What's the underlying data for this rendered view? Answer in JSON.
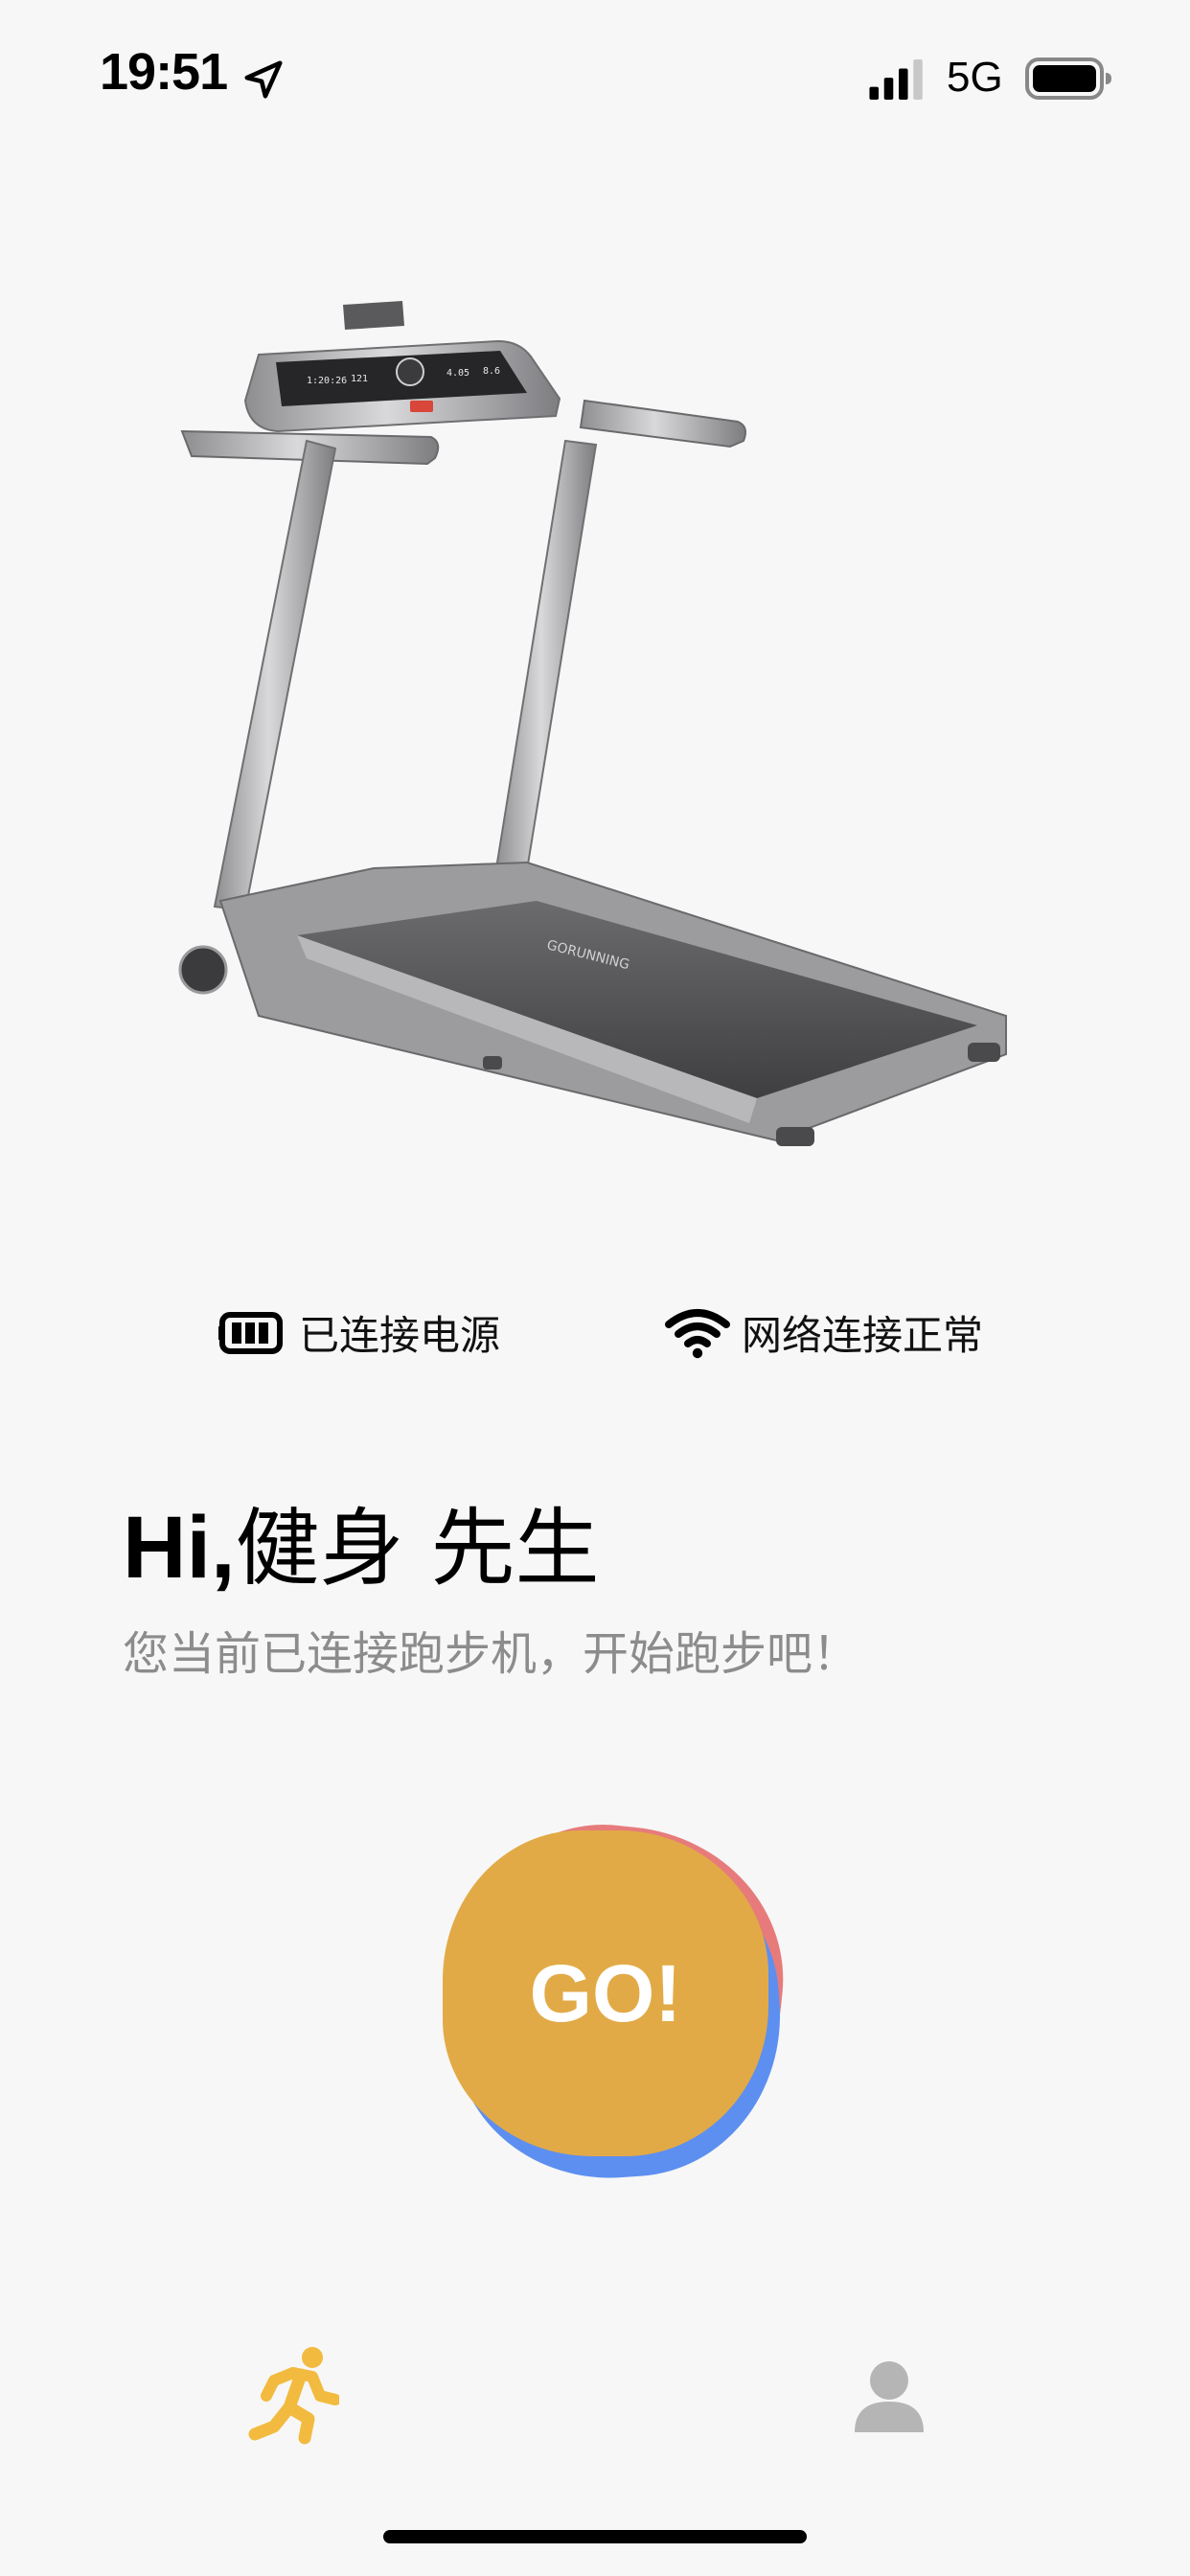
{
  "status_bar": {
    "time": "19:51",
    "network": "5G",
    "icons": [
      "location-arrow-icon",
      "signal-bars-icon",
      "battery-icon"
    ]
  },
  "hero": {
    "image": "treadmill-illustration",
    "console_readouts": [
      "1:20:26",
      "121",
      "4.05",
      "8.6"
    ]
  },
  "indicators": {
    "power": {
      "icon": "battery-full-icon",
      "label": "已连接电源"
    },
    "network": {
      "icon": "wifi-icon",
      "label": "网络连接正常"
    }
  },
  "greeting": {
    "hi": "Hi,",
    "name": "健身 先生",
    "subtitle": "您当前已连接跑步机，开始跑步吧！"
  },
  "go_button": {
    "label": "GO!",
    "colors": {
      "main": "#e2aa46",
      "back_red": "#e77b7b",
      "back_blue": "#5d8ff0"
    }
  },
  "tab_bar": {
    "tabs": [
      {
        "name": "run",
        "icon": "running-person-icon",
        "active": true,
        "color": "#f2bb3f"
      },
      {
        "name": "profile",
        "icon": "person-icon",
        "active": false,
        "color": "#b5b5b5"
      }
    ]
  }
}
